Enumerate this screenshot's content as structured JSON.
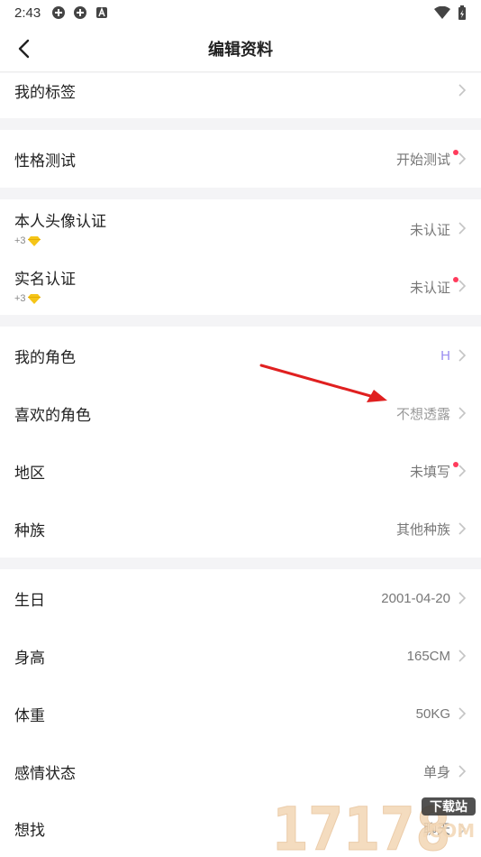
{
  "status": {
    "time": "2:43"
  },
  "nav": {
    "title": "编辑资料"
  },
  "tags": {
    "label": "我的标签"
  },
  "personality": {
    "label": "性格测试",
    "value": "开始测试"
  },
  "verify": {
    "avatar": {
      "label": "本人头像认证",
      "bonus": "+3",
      "value": "未认证"
    },
    "realname": {
      "label": "实名认证",
      "bonus": "+3",
      "value": "未认证"
    }
  },
  "roles": {
    "my_role": {
      "label": "我的角色",
      "value": "H"
    },
    "fav_role": {
      "label": "喜欢的角色",
      "value": "不想透露"
    },
    "region": {
      "label": "地区",
      "value": "未填写"
    },
    "race": {
      "label": "种族",
      "value": "其他种族"
    }
  },
  "profile": {
    "birthday": {
      "label": "生日",
      "value": "2001-04-20"
    },
    "height": {
      "label": "身高",
      "value": "165CM"
    },
    "weight": {
      "label": "体重",
      "value": "50KG"
    },
    "relationship": {
      "label": "感情状态",
      "value": "单身"
    },
    "seeking": {
      "label": "想找",
      "value": "聊天"
    }
  },
  "watermark": {
    "text": "17178",
    "sub": "下载站",
    "domain": ".COM"
  },
  "colors": {
    "accent_red": "#ff3b5c",
    "role_purple": "#9a8cf0",
    "arrow_red": "#e02020"
  }
}
